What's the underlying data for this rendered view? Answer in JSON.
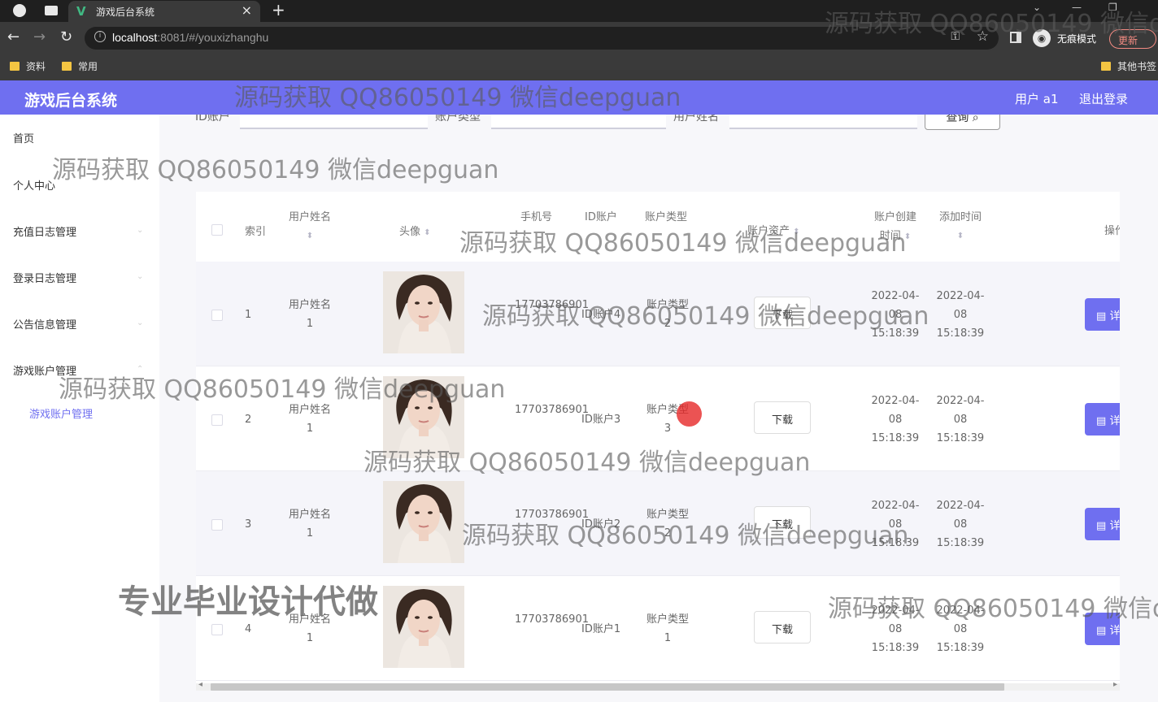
{
  "browser": {
    "tab_title": "游戏后台系统",
    "url_host": "localhost",
    "url_path": ":8081/#/youxizhanghu",
    "incognito_label": "无痕模式",
    "update_label": "更新",
    "bookmarks": [
      "资料",
      "常用"
    ],
    "other_bookmarks": "其他书签"
  },
  "header": {
    "title": "游戏后台系统",
    "user": "用户 a1",
    "logout": "退出登录",
    "accent_color": "#6f6ff0"
  },
  "sidebar": {
    "items": [
      {
        "label": "首页"
      },
      {
        "label": "个人中心"
      },
      {
        "label": "充值日志管理"
      },
      {
        "label": "登录日志管理"
      },
      {
        "label": "公告信息管理"
      },
      {
        "label": "游戏账户管理"
      }
    ],
    "sub_item": "游戏账户管理"
  },
  "search": {
    "labels": [
      "ID账户",
      "账户类型",
      "用户姓名"
    ],
    "button": "查询",
    "button_icon": "search-icon"
  },
  "table": {
    "headers": {
      "index": "索引",
      "name": "用户姓名",
      "avatar": "头像",
      "phone": "手机号",
      "account": "ID账户",
      "type": "账户类型",
      "asset": "账户资产",
      "created": "账户创建时间",
      "added": "添加时间",
      "action": "操作"
    },
    "download_label": "下载",
    "detail_label": "详情",
    "rows": [
      {
        "index": "1",
        "name": "用户姓名1",
        "phone": "17703786901",
        "account": "ID账户4",
        "type": "账户类型2",
        "created": "2022-04-08 15:18:39",
        "added": "2022-04-08 15:18:39"
      },
      {
        "index": "2",
        "name": "用户姓名1",
        "phone": "17703786901",
        "account": "ID账户3",
        "type": "账户类型3",
        "created": "2022-04-08 15:18:39",
        "added": "2022-04-08 15:18:39"
      },
      {
        "index": "3",
        "name": "用户姓名1",
        "phone": "17703786901",
        "account": "ID账户2",
        "type": "账户类型2",
        "created": "2022-04-08 15:18:39",
        "added": "2022-04-08 15:18:39"
      },
      {
        "index": "4",
        "name": "用户姓名1",
        "phone": "17703786901",
        "account": "ID账户1",
        "type": "账户类型1",
        "created": "2022-04-08 15:18:39",
        "added": "2022-04-08 15:18:39"
      }
    ]
  },
  "watermarks": {
    "text": "源码获取 QQ86050149 微信deepguan",
    "text_cut": "源码获取 QQ86050149 微信d",
    "big": "专业毕业设计代做"
  }
}
